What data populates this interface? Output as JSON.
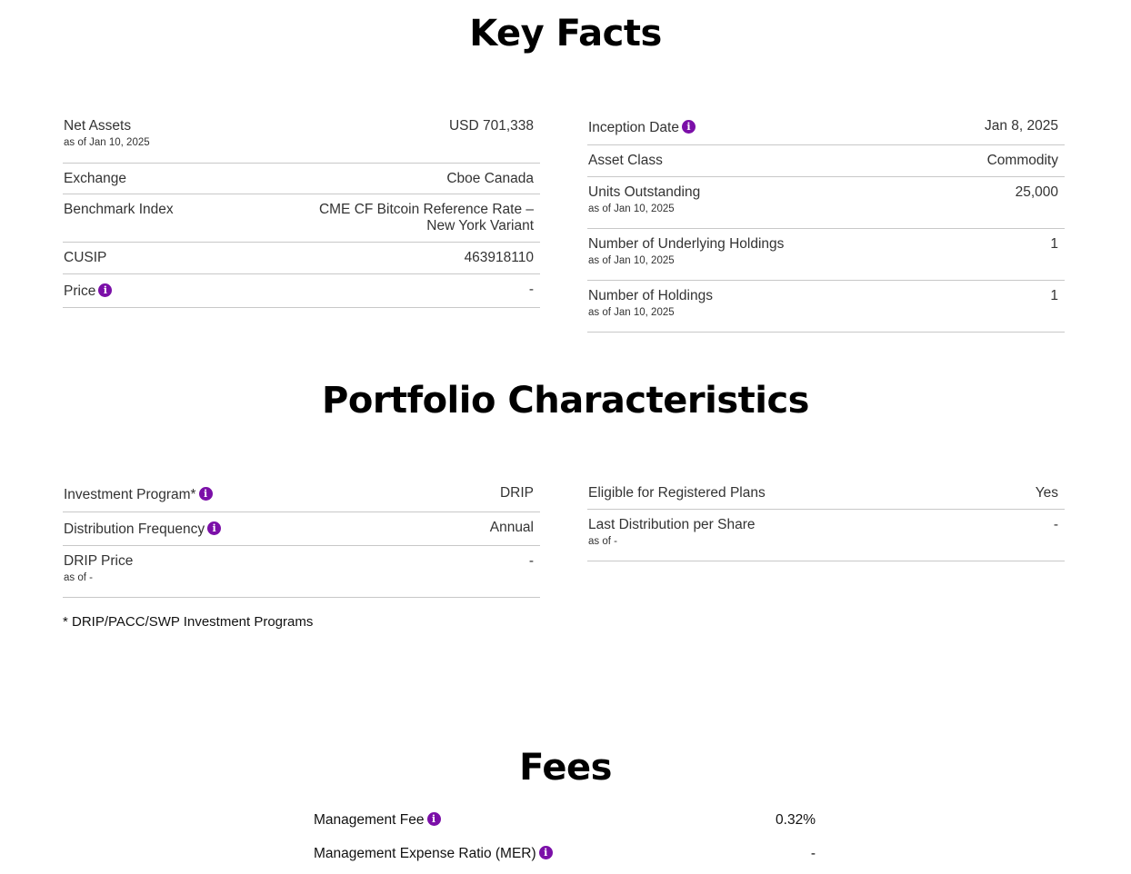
{
  "key_facts": {
    "title": "Key Facts",
    "left": [
      {
        "label": "Net Assets",
        "sub": "as of Jan 10, 2025",
        "value": "USD 701,338"
      },
      {
        "label": "Exchange",
        "value": "Cboe Canada"
      },
      {
        "label": "Benchmark Index",
        "value_line1": "CME CF Bitcoin Reference Rate –",
        "value_line2": "New York Variant"
      },
      {
        "label": "CUSIP",
        "value": "463918110"
      },
      {
        "label": "Price",
        "value": "-",
        "info": "info-icon"
      }
    ],
    "right": [
      {
        "label": "Inception Date",
        "value": "Jan 8, 2025",
        "info": "info-icon"
      },
      {
        "label": "Asset Class",
        "value": "Commodity"
      },
      {
        "label": "Units Outstanding",
        "sub": "as of Jan 10, 2025",
        "value": "25,000"
      },
      {
        "label": "Number of Underlying Holdings",
        "sub": "as of Jan 10, 2025",
        "value": "1"
      },
      {
        "label": "Number of Holdings",
        "sub": "as of Jan 10, 2025",
        "value": "1"
      }
    ]
  },
  "portfolio": {
    "title": "Portfolio Characteristics",
    "left": [
      {
        "label": "Investment Program*",
        "value": "DRIP",
        "info": "info-icon"
      },
      {
        "label": "Distribution Frequency",
        "value": "Annual",
        "info": "info-icon"
      },
      {
        "label": "DRIP Price",
        "sub": "as of -",
        "value": "-"
      }
    ],
    "right": [
      {
        "label": "Eligible for Registered Plans",
        "value": "Yes"
      },
      {
        "label": "Last Distribution per Share",
        "sub": "as of -",
        "value": "-"
      }
    ],
    "footnote": "* DRIP/PACC/SWP Investment Programs"
  },
  "fees": {
    "title": "Fees",
    "rows": [
      {
        "label": "Management Fee",
        "value": "0.32%",
        "info": "info-icon"
      },
      {
        "label": "Management Expense Ratio (MER)",
        "value": "-",
        "info": "info-icon"
      }
    ]
  },
  "icons": {
    "info_glyph": "i"
  },
  "colors": {
    "info_accent": "#7b0fa8",
    "divider": "#c8c8c8"
  }
}
